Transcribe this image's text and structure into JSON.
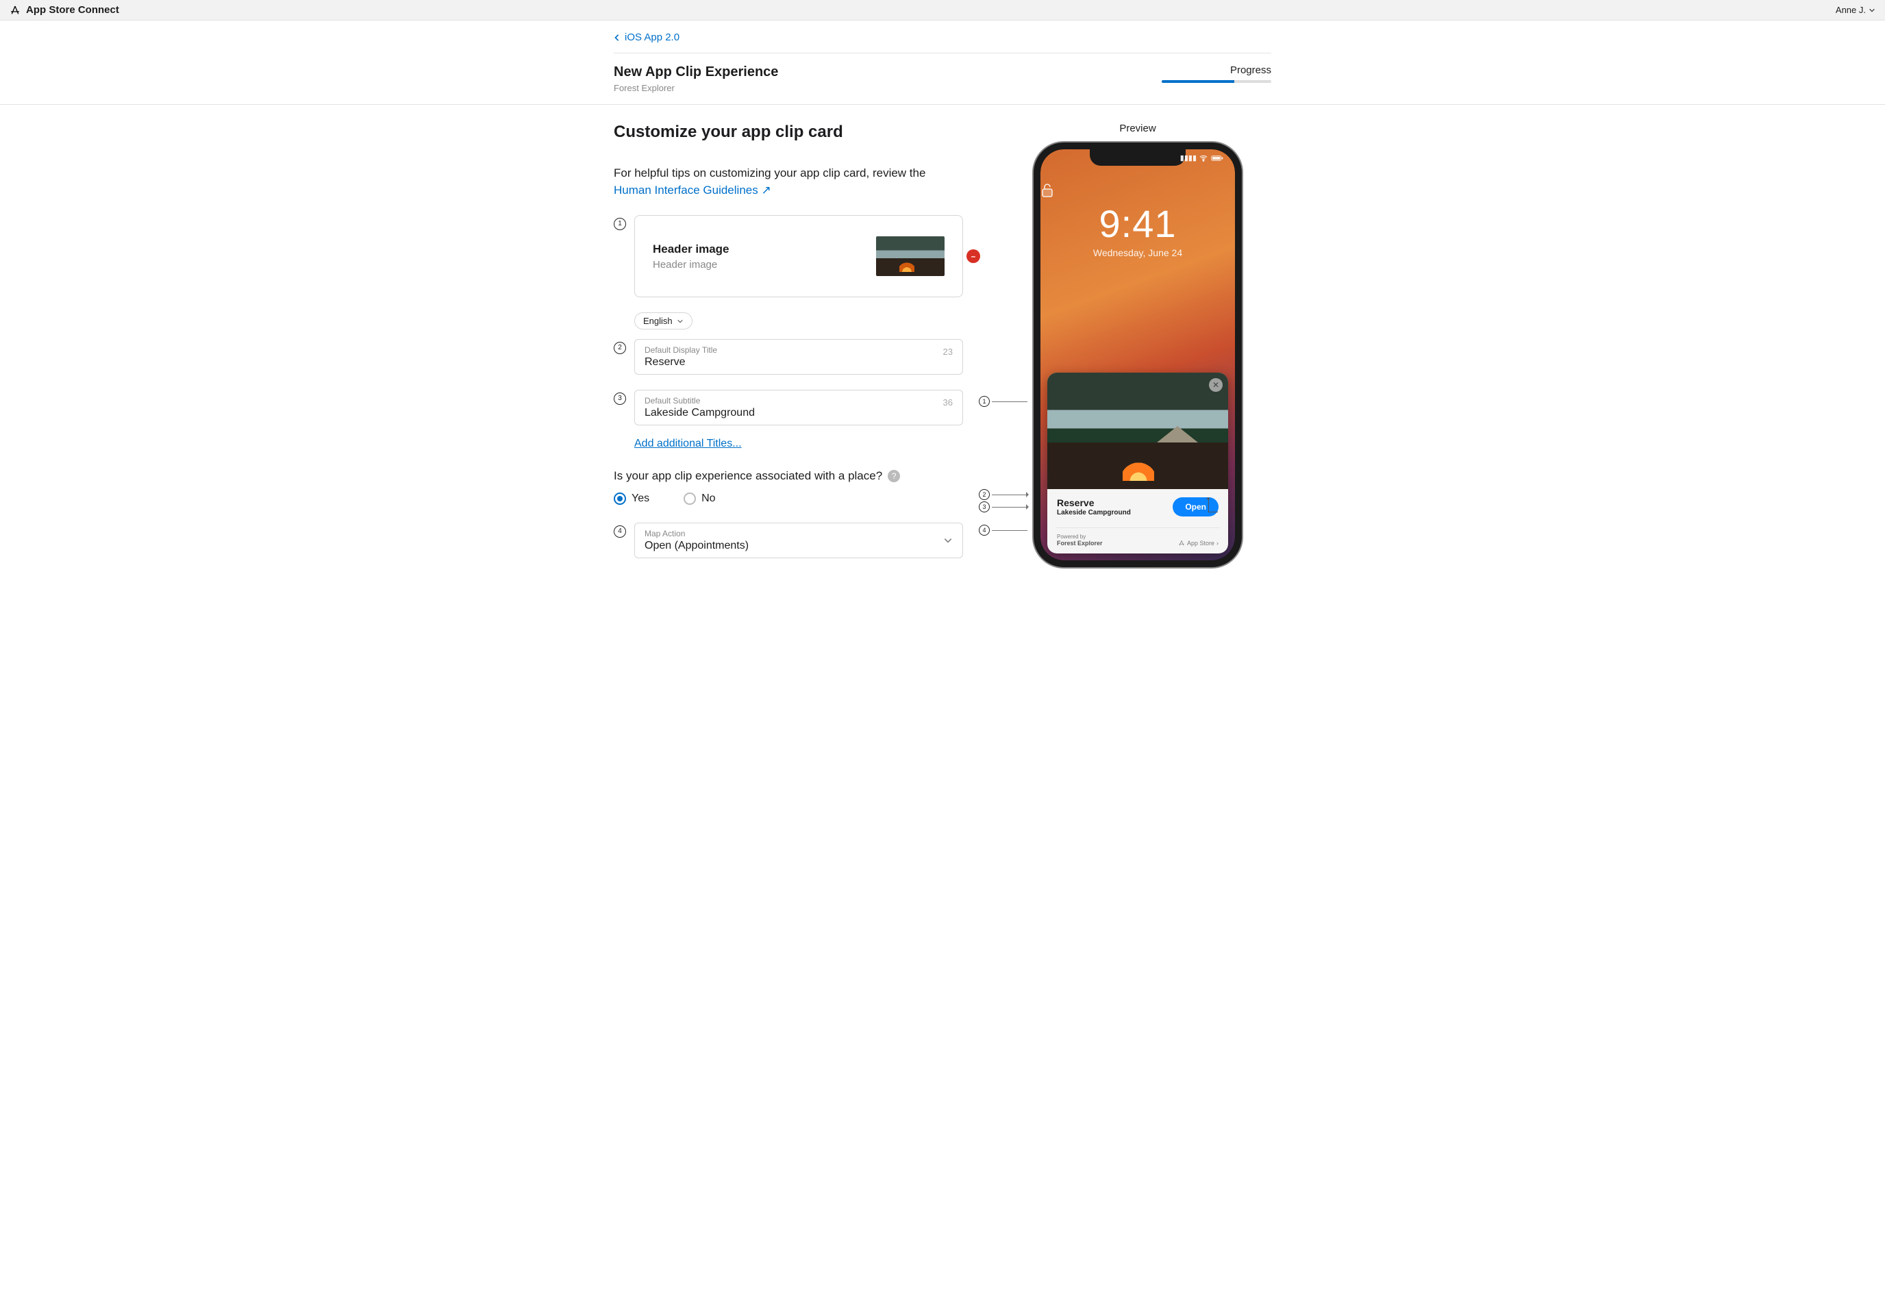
{
  "topbar": {
    "app_name": "App Store Connect",
    "user_name": "Anne J."
  },
  "breadcrumb": {
    "back_label": "iOS App 2.0"
  },
  "header": {
    "title": "New App Clip Experience",
    "subtitle": "Forest Explorer",
    "progress_label": "Progress",
    "progress_percent": 66
  },
  "customize": {
    "heading": "Customize your app clip card",
    "intro_prefix": "For helpful tips on customizing your app clip card, review the ",
    "hig_link": "Human Interface Guidelines",
    "header_image": {
      "title": "Header image",
      "subtitle": "Header image"
    },
    "language_selector": "English",
    "title_field": {
      "label": "Default Display Title",
      "value": "Reserve",
      "remaining": "23"
    },
    "subtitle_field": {
      "label": "Default Subtitle",
      "value": "Lakeside Campground",
      "remaining": "36"
    },
    "add_titles": "Add additional Titles...",
    "place_question": "Is your app clip experience associated with a place?",
    "yes": "Yes",
    "no": "No",
    "map_action": {
      "label": "Map Action",
      "value": "Open (Appointments)"
    }
  },
  "preview": {
    "label": "Preview",
    "lock_time": "9:41",
    "lock_date": "Wednesday, June 24",
    "card_title": "Reserve",
    "card_subtitle": "Lakeside Campground",
    "open_button": "Open",
    "powered_by_label": "Powered by",
    "powered_by_app": "Forest Explorer",
    "appstore_label": "App Store"
  }
}
